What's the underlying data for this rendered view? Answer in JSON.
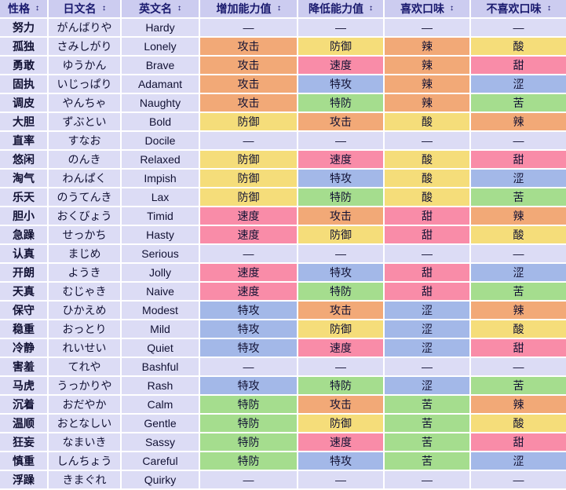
{
  "table": {
    "columns": [
      {
        "label": "性格",
        "key": "nature",
        "sort_icon": "sort-updown-icon"
      },
      {
        "label": "日文名",
        "key": "jp",
        "sort_icon": "sort-updown-icon"
      },
      {
        "label": "英文名",
        "key": "en",
        "sort_icon": "sort-updown-icon"
      },
      {
        "label": "增加能力值",
        "key": "up",
        "sort_icon": "sort-updown-icon"
      },
      {
        "label": "降低能力值",
        "key": "down",
        "sort_icon": "sort-updown-icon"
      },
      {
        "label": "喜欢口味",
        "key": "like",
        "sort_icon": "sort-updown-icon"
      },
      {
        "label": "不喜欢口味",
        "key": "dislike",
        "sort_icon": "sort-updown-icon"
      }
    ],
    "colors": {
      "header_bg": "#ccccf0",
      "base_cell_bg": "#dcdcf5",
      "border": "#ffffff",
      "attack": "#f2a977",
      "defense": "#f5dd7a",
      "speed": "#f98ca8",
      "sp_attack": "#a3b8e8",
      "sp_defense": "#a5dd8e"
    },
    "rows": [
      {
        "nature": "努力",
        "jp": "がんばりや",
        "en": "Hardy",
        "up": "—",
        "up_c": "v-none",
        "down": "—",
        "down_c": "v-none",
        "like": "—",
        "like_c": "f-none",
        "dislike": "—",
        "dislike_c": "f-none"
      },
      {
        "nature": "孤独",
        "jp": "さみしがり",
        "en": "Lonely",
        "up": "攻击",
        "up_c": "v-atk",
        "down": "防御",
        "down_c": "v-def",
        "like": "辣",
        "like_c": "f-spicy",
        "dislike": "酸",
        "dislike_c": "f-sour"
      },
      {
        "nature": "勇敢",
        "jp": "ゆうかん",
        "en": "Brave",
        "up": "攻击",
        "up_c": "v-atk",
        "down": "速度",
        "down_c": "v-spe",
        "like": "辣",
        "like_c": "f-spicy",
        "dislike": "甜",
        "dislike_c": "f-sweet"
      },
      {
        "nature": "固执",
        "jp": "いじっぱり",
        "en": "Adamant",
        "up": "攻击",
        "up_c": "v-atk",
        "down": "特攻",
        "down_c": "v-spa",
        "like": "辣",
        "like_c": "f-spicy",
        "dislike": "涩",
        "dislike_c": "f-dry"
      },
      {
        "nature": "调皮",
        "jp": "やんちゃ",
        "en": "Naughty",
        "up": "攻击",
        "up_c": "v-atk",
        "down": "特防",
        "down_c": "v-spd",
        "like": "辣",
        "like_c": "f-spicy",
        "dislike": "苦",
        "dislike_c": "f-bitter"
      },
      {
        "nature": "大胆",
        "jp": "ずぶとい",
        "en": "Bold",
        "up": "防御",
        "up_c": "v-def",
        "down": "攻击",
        "down_c": "v-atk",
        "like": "酸",
        "like_c": "f-sour",
        "dislike": "辣",
        "dislike_c": "f-spicy"
      },
      {
        "nature": "直率",
        "jp": "すなお",
        "en": "Docile",
        "up": "—",
        "up_c": "v-none",
        "down": "—",
        "down_c": "v-none",
        "like": "—",
        "like_c": "f-none",
        "dislike": "—",
        "dislike_c": "f-none"
      },
      {
        "nature": "悠闲",
        "jp": "のんき",
        "en": "Relaxed",
        "up": "防御",
        "up_c": "v-def",
        "down": "速度",
        "down_c": "v-spe",
        "like": "酸",
        "like_c": "f-sour",
        "dislike": "甜",
        "dislike_c": "f-sweet"
      },
      {
        "nature": "淘气",
        "jp": "わんぱく",
        "en": "Impish",
        "up": "防御",
        "up_c": "v-def",
        "down": "特攻",
        "down_c": "v-spa",
        "like": "酸",
        "like_c": "f-sour",
        "dislike": "涩",
        "dislike_c": "f-dry"
      },
      {
        "nature": "乐天",
        "jp": "のうてんき",
        "en": "Lax",
        "up": "防御",
        "up_c": "v-def",
        "down": "特防",
        "down_c": "v-spd",
        "like": "酸",
        "like_c": "f-sour",
        "dislike": "苦",
        "dislike_c": "f-bitter"
      },
      {
        "nature": "胆小",
        "jp": "おくびょう",
        "en": "Timid",
        "up": "速度",
        "up_c": "v-spe",
        "down": "攻击",
        "down_c": "v-atk",
        "like": "甜",
        "like_c": "f-sweet",
        "dislike": "辣",
        "dislike_c": "f-spicy"
      },
      {
        "nature": "急躁",
        "jp": "せっかち",
        "en": "Hasty",
        "up": "速度",
        "up_c": "v-spe",
        "down": "防御",
        "down_c": "v-def",
        "like": "甜",
        "like_c": "f-sweet",
        "dislike": "酸",
        "dislike_c": "f-sour"
      },
      {
        "nature": "认真",
        "jp": "まじめ",
        "en": "Serious",
        "up": "—",
        "up_c": "v-none",
        "down": "—",
        "down_c": "v-none",
        "like": "—",
        "like_c": "f-none",
        "dislike": "—",
        "dislike_c": "f-none"
      },
      {
        "nature": "开朗",
        "jp": "ようき",
        "en": "Jolly",
        "up": "速度",
        "up_c": "v-spe",
        "down": "特攻",
        "down_c": "v-spa",
        "like": "甜",
        "like_c": "f-sweet",
        "dislike": "涩",
        "dislike_c": "f-dry"
      },
      {
        "nature": "天真",
        "jp": "むじゃき",
        "en": "Naive",
        "up": "速度",
        "up_c": "v-spe",
        "down": "特防",
        "down_c": "v-spd",
        "like": "甜",
        "like_c": "f-sweet",
        "dislike": "苦",
        "dislike_c": "f-bitter"
      },
      {
        "nature": "保守",
        "jp": "ひかえめ",
        "en": "Modest",
        "up": "特攻",
        "up_c": "v-spa",
        "down": "攻击",
        "down_c": "v-atk",
        "like": "涩",
        "like_c": "f-dry",
        "dislike": "辣",
        "dislike_c": "f-spicy"
      },
      {
        "nature": "稳重",
        "jp": "おっとり",
        "en": "Mild",
        "up": "特攻",
        "up_c": "v-spa",
        "down": "防御",
        "down_c": "v-def",
        "like": "涩",
        "like_c": "f-dry",
        "dislike": "酸",
        "dislike_c": "f-sour"
      },
      {
        "nature": "冷静",
        "jp": "れいせい",
        "en": "Quiet",
        "up": "特攻",
        "up_c": "v-spa",
        "down": "速度",
        "down_c": "v-spe",
        "like": "涩",
        "like_c": "f-dry",
        "dislike": "甜",
        "dislike_c": "f-sweet"
      },
      {
        "nature": "害羞",
        "jp": "てれや",
        "en": "Bashful",
        "up": "—",
        "up_c": "v-none",
        "down": "—",
        "down_c": "v-none",
        "like": "—",
        "like_c": "f-none",
        "dislike": "—",
        "dislike_c": "f-none"
      },
      {
        "nature": "马虎",
        "jp": "うっかりや",
        "en": "Rash",
        "up": "特攻",
        "up_c": "v-spa",
        "down": "特防",
        "down_c": "v-spd",
        "like": "涩",
        "like_c": "f-dry",
        "dislike": "苦",
        "dislike_c": "f-bitter"
      },
      {
        "nature": "沉着",
        "jp": "おだやか",
        "en": "Calm",
        "up": "特防",
        "up_c": "v-spd",
        "down": "攻击",
        "down_c": "v-atk",
        "like": "苦",
        "like_c": "f-bitter",
        "dislike": "辣",
        "dislike_c": "f-spicy"
      },
      {
        "nature": "温顺",
        "jp": "おとなしい",
        "en": "Gentle",
        "up": "特防",
        "up_c": "v-spd",
        "down": "防御",
        "down_c": "v-def",
        "like": "苦",
        "like_c": "f-bitter",
        "dislike": "酸",
        "dislike_c": "f-sour"
      },
      {
        "nature": "狂妄",
        "jp": "なまいき",
        "en": "Sassy",
        "up": "特防",
        "up_c": "v-spd",
        "down": "速度",
        "down_c": "v-spe",
        "like": "苦",
        "like_c": "f-bitter",
        "dislike": "甜",
        "dislike_c": "f-sweet"
      },
      {
        "nature": "慎重",
        "jp": "しんちょう",
        "en": "Careful",
        "up": "特防",
        "up_c": "v-spd",
        "down": "特攻",
        "down_c": "v-spa",
        "like": "苦",
        "like_c": "f-bitter",
        "dislike": "涩",
        "dislike_c": "f-dry"
      },
      {
        "nature": "浮躁",
        "jp": "きまぐれ",
        "en": "Quirky",
        "up": "—",
        "up_c": "v-none",
        "down": "—",
        "down_c": "v-none",
        "like": "—",
        "like_c": "f-none",
        "dislike": "—",
        "dislike_c": "f-none"
      }
    ]
  }
}
